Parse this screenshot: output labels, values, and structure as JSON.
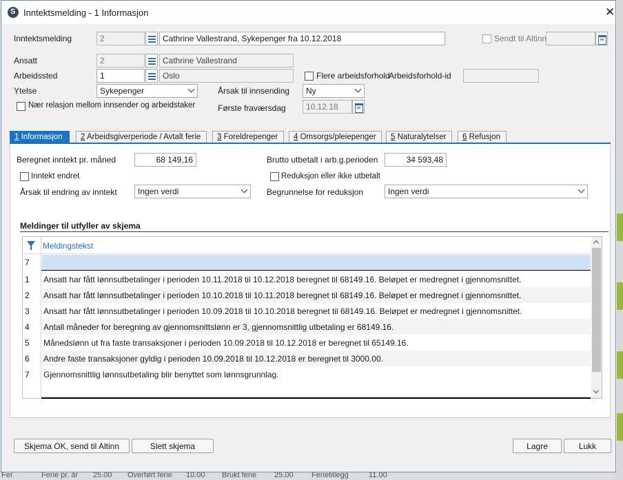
{
  "background": {
    "strip_texts": [
      "Fer",
      "Ferie pr. år",
      "25.00",
      "Overført ferie",
      "10.00",
      "Brukt ferie",
      "25.00",
      "Ferietillegg",
      "11.00"
    ]
  },
  "window": {
    "title": "Inntektsmelding - 1 Informasjon",
    "close_label": "✕"
  },
  "header": {
    "inntektsmelding_label": "Inntektsmelding",
    "inntektsmelding_id": "2",
    "inntektsmelding_desc": "Cathrine Vallestrand, Sykepenger fra 10.12.2018",
    "sendt_altinn_label": "Sendt til Altinn",
    "sendt_altinn_date": "",
    "ansatt_label": "Ansatt",
    "ansatt_id": "2",
    "ansatt_name": "Cathrine Vallestrand",
    "arbeidssted_label": "Arbeidssted",
    "arbeidssted_id": "1",
    "arbeidssted_name": "Oslo",
    "flere_arbeidsforhold_label": "Flere arbeidsforhold",
    "arbeidsforhold_id_label": "Arbeidsforhold-id",
    "arbeidsforhold_id_value": "",
    "ytelse_label": "Ytelse",
    "ytelse_value": "Sykepenger",
    "aarsak_innsending_label": "Årsak til innsending",
    "aarsak_innsending_value": "Ny",
    "naer_relasjon_label": "Nær relasjon mellom innsender og arbeidstaker",
    "forste_fravaersdag_label": "Første fraværsdag",
    "forste_fravaersdag_value": "10.12.18"
  },
  "tabs": [
    {
      "num": "1",
      "label": " Informasjon"
    },
    {
      "num": "2",
      "label": " Arbeidsgiverperiode / Avtalt ferie"
    },
    {
      "num": "3",
      "label": " Foreldrepenger"
    },
    {
      "num": "4",
      "label": " Omsorgs/pleiepenger"
    },
    {
      "num": "5",
      "label": " Naturalytelser"
    },
    {
      "num": "6",
      "label": " Refusjon"
    }
  ],
  "form": {
    "beregnet_label": "Beregnet inntekt pr. måned",
    "beregnet_value": "68 149,16",
    "brutto_label": "Brutto utbetalt i arb.g.perioden",
    "brutto_value": "34 593,48",
    "inntekt_endret_label": "Inntekt endret",
    "reduksjon_label": "Reduksjon eller ikke utbetalt",
    "aarsak_endring_label": "Årsak til endring av inntekt",
    "aarsak_endring_value": "Ingen verdi",
    "begrunnelse_label": "Begrunnelse for reduksjon",
    "begrunnelse_value": "Ingen verdi"
  },
  "messages": {
    "section_title": "Meldinger til utfyller av skjema",
    "column_header": "Meldingstekst",
    "count": "7",
    "rows": [
      {
        "n": "1",
        "text": "Ansatt har fått lønnsutbetalinger i perioden 10.11.2018 til 10.12.2018 beregnet til 68149.16. Beløpet er medregnet i gjennomsnittet."
      },
      {
        "n": "2",
        "text": "Ansatt har fått lønnsutbetalinger i perioden 10.10.2018 til 10.11.2018 beregnet til 68149.16. Beløpet er medregnet i gjennomsnittet."
      },
      {
        "n": "3",
        "text": "Ansatt har fått lønnsutbetalinger i perioden 10.09.2018 til 10.10.2018 beregnet til 68149.16. Beløpet er medregnet i gjennomsnittet."
      },
      {
        "n": "4",
        "text": "Antall måneder for beregning av gjennomsnittslønn er 3, gjennomsnittlig utbetaling er 68149.16."
      },
      {
        "n": "5",
        "text": "Månedslønn ut fra faste transaksjoner i perioden 10.09.2018 til 10.12.2018 er beregnet til 65149.16."
      },
      {
        "n": "6",
        "text": "Andre faste transaksjoner gyldig i perioden 10.09.2018 til 10.12.2018 er beregnet til 3000.00."
      },
      {
        "n": "7",
        "text": "Gjennomsnittlig lønnsutbetaling blir benyttet som lønnsgrunnlag."
      }
    ]
  },
  "buttons": {
    "skjema_ok": "Skjema OK, send til Altinn",
    "slett": "Slett skjema",
    "lagre": "Lagre",
    "lukk": "Lukk"
  },
  "colors": {
    "accent": "#1c73c2",
    "selected_row": "#cfe3f6",
    "link_text": "#2c6fb3"
  },
  "icons": [
    "app-logo-icon",
    "close-icon",
    "list-lookup-icon",
    "calendar-icon",
    "chevron-down-icon",
    "filter-icon",
    "scroll-up-icon",
    "scroll-down-icon"
  ]
}
